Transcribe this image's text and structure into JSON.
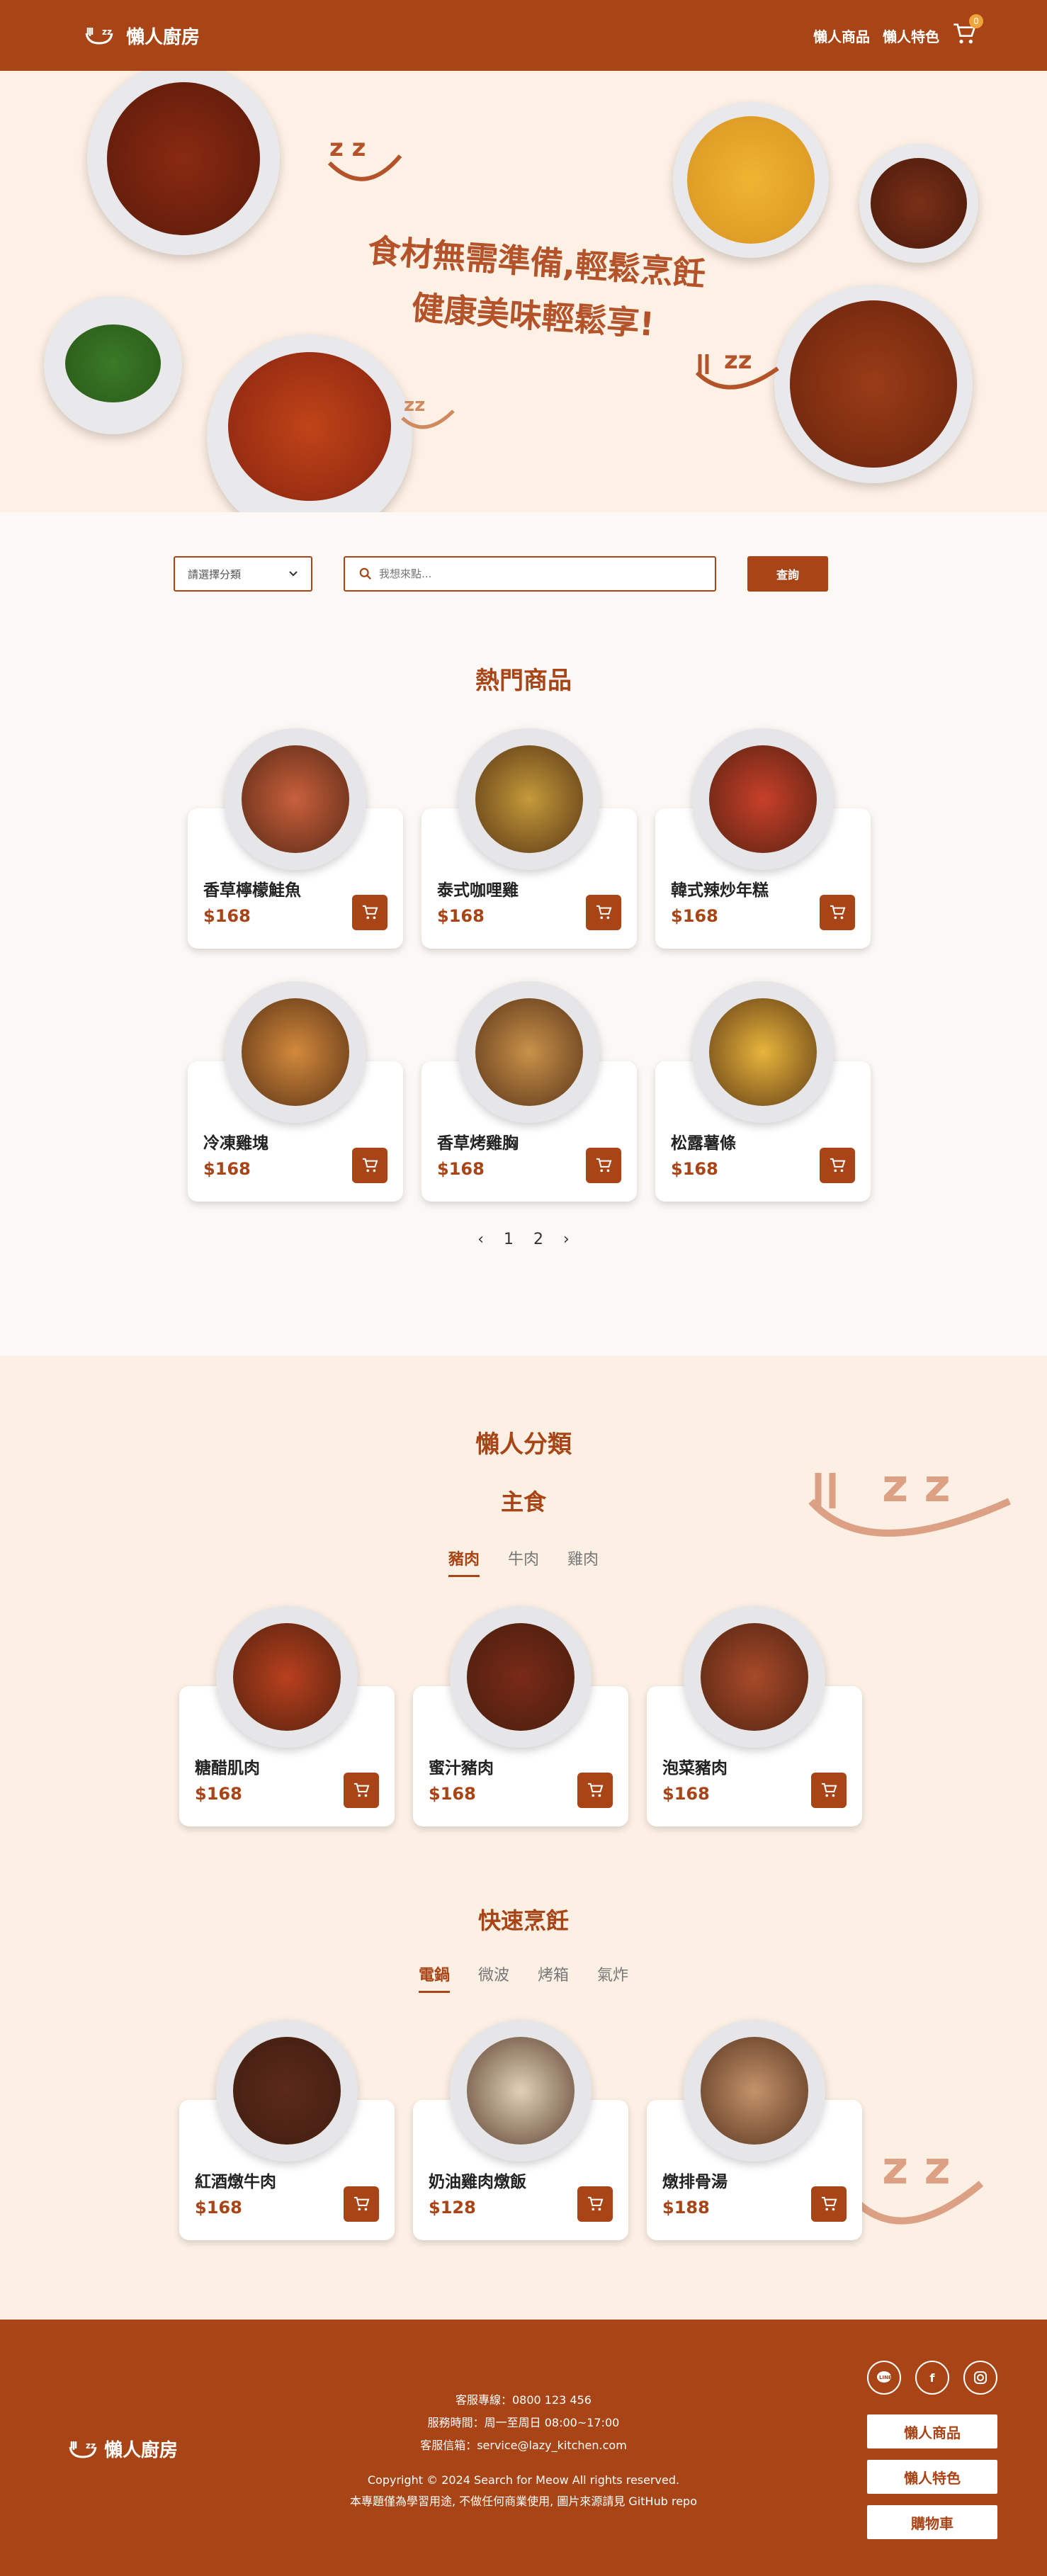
{
  "header": {
    "logo_text": "懶人廚房",
    "nav": [
      "懶人商品",
      "懶人特色"
    ],
    "cart_count": "0"
  },
  "hero": {
    "line1": "食材無需準備,輕鬆烹飪",
    "line2": "健康美味輕鬆享!"
  },
  "search": {
    "select_label": "請選擇分類",
    "placeholder": "我想來點...",
    "button": "查詢"
  },
  "popular": {
    "title": "熱門商品",
    "items": [
      {
        "name": "香草檸檬鮭魚",
        "price": "$168",
        "color": "#c8603c"
      },
      {
        "name": "泰式咖哩雞",
        "price": "$168",
        "color": "#c59a3a"
      },
      {
        "name": "韓式辣炒年糕",
        "price": "$168",
        "color": "#c8402a"
      },
      {
        "name": "冷凍雞塊",
        "price": "$168",
        "color": "#d28a3c"
      },
      {
        "name": "香草烤雞胸",
        "price": "$168",
        "color": "#c9924a"
      },
      {
        "name": "松露薯條",
        "price": "$168",
        "color": "#e8b53c"
      }
    ],
    "pages": [
      "1",
      "2"
    ]
  },
  "category": {
    "title": "懶人分類",
    "main": {
      "title": "主食",
      "tabs": [
        "豬肉",
        "牛肉",
        "雞肉"
      ],
      "items": [
        {
          "name": "糖醋肌肉",
          "price": "$168",
          "color": "#b8401e"
        },
        {
          "name": "蜜汁豬肉",
          "price": "$168",
          "color": "#7a2a18"
        },
        {
          "name": "泡菜豬肉",
          "price": "$168",
          "color": "#a84a2a"
        }
      ]
    },
    "quick": {
      "title": "快速烹飪",
      "tabs": [
        "電鍋",
        "微波",
        "烤箱",
        "氣炸"
      ],
      "items": [
        {
          "name": "紅酒燉牛肉",
          "price": "$168",
          "color": "#5a2a1c"
        },
        {
          "name": "奶油雞肉燉飯",
          "price": "$128",
          "color": "#e0d2b8"
        },
        {
          "name": "燉排骨湯",
          "price": "$188",
          "color": "#c4936a"
        }
      ]
    }
  },
  "footer": {
    "logo_text": "懶人廚房",
    "phone": "客服專線：0800 123 456",
    "hours": "服務時間：周一至周日 08:00~17:00",
    "email": "客服信箱：service@lazy_kitchen.com",
    "copyright": "Copyright © 2024 Search for Meow All rights reserved.",
    "disclaimer": "本專題僅為學習用途, 不做任何商業使用, 圖片來源請見 GitHub repo",
    "buttons": [
      "懶人商品",
      "懶人特色",
      "購物車"
    ],
    "socials": [
      "line-icon",
      "facebook-icon",
      "instagram-icon"
    ]
  }
}
